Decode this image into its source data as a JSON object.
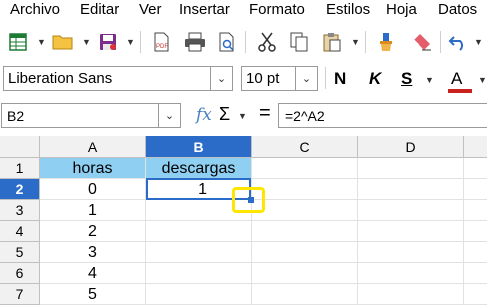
{
  "menu": [
    "Archivo",
    "Editar",
    "Ver",
    "Insertar",
    "Formato",
    "Estilos",
    "Hoja",
    "Datos"
  ],
  "toolbar1": {
    "icons": [
      "new-spreadsheet-icon",
      "open-folder-icon",
      "save-icon",
      "export-pdf-icon",
      "print-icon",
      "print-preview-icon",
      "cut-icon",
      "copy-icon",
      "paste-icon",
      "clone-formatting-icon",
      "clear-formatting-icon",
      "undo-icon"
    ]
  },
  "toolbar2": {
    "font_name": "Liberation Sans",
    "font_size": "10 pt",
    "bold_label": "N",
    "italic_label": "K",
    "underline_label": "S",
    "font_color_label": "A",
    "font_color": "#c9211e"
  },
  "formula_bar": {
    "name_box": "B2",
    "fx_label": "fx",
    "sum_label": "Σ",
    "equals_label": "=",
    "formula": "=2^A2"
  },
  "sheet": {
    "columns": [
      "A",
      "B",
      "C",
      "D"
    ],
    "active_column": "B",
    "rows": [
      "1",
      "2",
      "3",
      "4",
      "5",
      "6",
      "7"
    ],
    "active_row": "2",
    "col_a": [
      "horas",
      "0",
      "1",
      "2",
      "3",
      "4",
      "5"
    ],
    "col_b": [
      "descargas",
      "1",
      "",
      "",
      "",
      "",
      ""
    ],
    "header_fill": "#8ecff2",
    "selection_color": "#2a6cc8",
    "highlight_color": "#ffe600"
  }
}
